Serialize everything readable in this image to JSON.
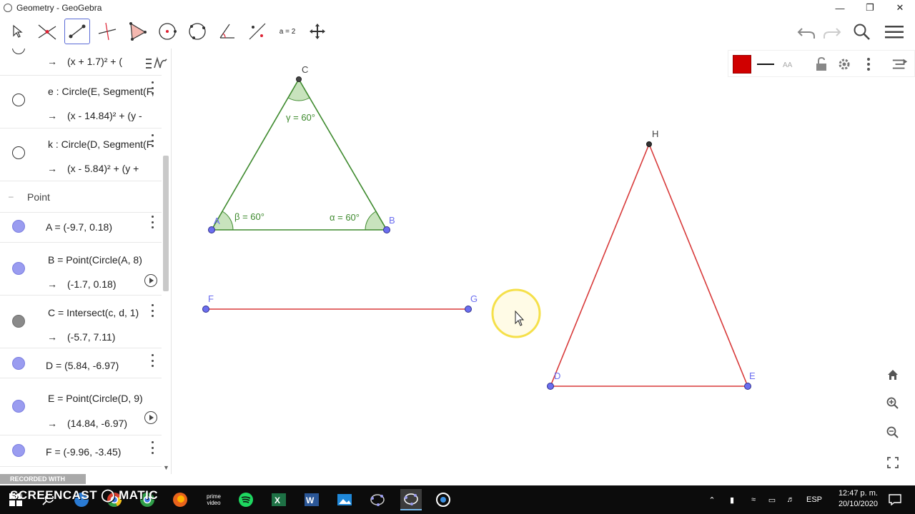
{
  "window": {
    "title": "Geometry - GeoGebra",
    "min_icon": "minimize-icon",
    "max_icon": "restore-icon",
    "close_icon": "close-icon"
  },
  "toolbar": {
    "tools": [
      "move-tool",
      "point-tool",
      "segment-tool",
      "perpendicular-tool",
      "polygon-tool",
      "circle-tool",
      "circle-three-points-tool",
      "angle-tool",
      "reflect-tool",
      "slider-tool",
      "move-graphics-tool"
    ],
    "slider_label": "a = 2",
    "right_icons": [
      "undo-icon",
      "redo-icon",
      "search-icon",
      "menu-icon"
    ]
  },
  "algebra": {
    "rows": [
      {
        "value": "(x + 1.7)² + ("
      },
      {
        "def": "e : Circle(E, Segment(F,",
        "value": "(x - 14.84)² + (y -"
      },
      {
        "def": "k : Circle(D, Segment(F",
        "value": "(x - 5.84)² + (y +"
      }
    ],
    "section_label": "Point",
    "arrow": "→",
    "points": [
      {
        "text": "A = (-9.7, 0.18)"
      },
      {
        "def": "B = Point(Circle(A, 8)",
        "value": "(-1.7, 0.18)"
      },
      {
        "def": "C = Intersect(c, d, 1)",
        "value": "(-5.7, 7.11)"
      },
      {
        "text": "D = (5.84, -6.97)"
      },
      {
        "def": "E = Point(Circle(D, 9)",
        "value": "(14.84, -6.97)"
      },
      {
        "text": "F = (-9.96, -3.45)"
      }
    ]
  },
  "graphics": {
    "labels": {
      "A": "A",
      "B": "B",
      "C": "C",
      "D": "D",
      "E": "E",
      "F": "F",
      "G": "G",
      "H": "H"
    },
    "angles": {
      "alpha": "α = 60°",
      "beta": "β = 60°",
      "gamma": "γ = 60°"
    },
    "colors": {
      "triangle1": "#3e8a2e",
      "triangle2": "#d83a3a",
      "segment": "#d83a3a",
      "point": "#6b6ef0",
      "angle_fill": "#c8e3bd",
      "highlight": "#f5e04a"
    },
    "style_bar": {
      "color": "#d00000",
      "icons": [
        "line-style-icon",
        "label-style-icon",
        "lock-icon",
        "gear-icon",
        "more-icon",
        "toggle-style-bar-icon"
      ]
    },
    "zoom_buttons": [
      "home-icon",
      "zoom-in-icon",
      "zoom-out-icon",
      "fullscreen-icon"
    ]
  },
  "recording": {
    "top": "RECORDED WITH",
    "brand": "SCREENCAST ◯ MATIC"
  },
  "taskbar": {
    "apps": [
      "start-icon",
      "search-icon",
      "edge-icon",
      "chrome-icon",
      "firefox-icon",
      "prime-video-icon",
      "spotify-icon",
      "excel-icon",
      "word-icon",
      "photos-icon",
      "geogebra-classic-icon",
      "geogebra-icon",
      "obs-icon"
    ],
    "prime_label": "prime video",
    "lang": "ESP",
    "time": "12:47 p. m.",
    "date": "20/10/2020"
  }
}
